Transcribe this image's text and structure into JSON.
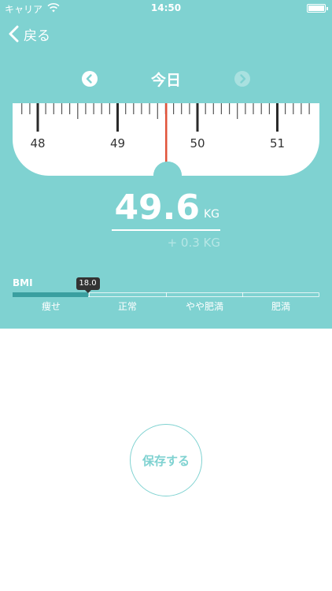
{
  "status_bar": {
    "carrier": "キャリア",
    "time": "14:50"
  },
  "nav": {
    "back_label": "戻る"
  },
  "date": {
    "title": "今日"
  },
  "scale": {
    "labels": [
      "48",
      "49",
      "50",
      "51"
    ],
    "current_value": 49.6
  },
  "weight": {
    "value": "49.6",
    "unit": "KG",
    "delta": "+ 0.3 KG"
  },
  "bmi": {
    "label": "BMI",
    "value_badge": "18.0",
    "categories": [
      "痩せ",
      "正常",
      "やや肥満",
      "肥満"
    ],
    "indicator_fraction": 0.245
  },
  "actions": {
    "save_label": "保存する"
  },
  "colors": {
    "accent": "#7fd2d1",
    "needle": "#e0533a",
    "bmi_fill": "#3a9fa0"
  }
}
